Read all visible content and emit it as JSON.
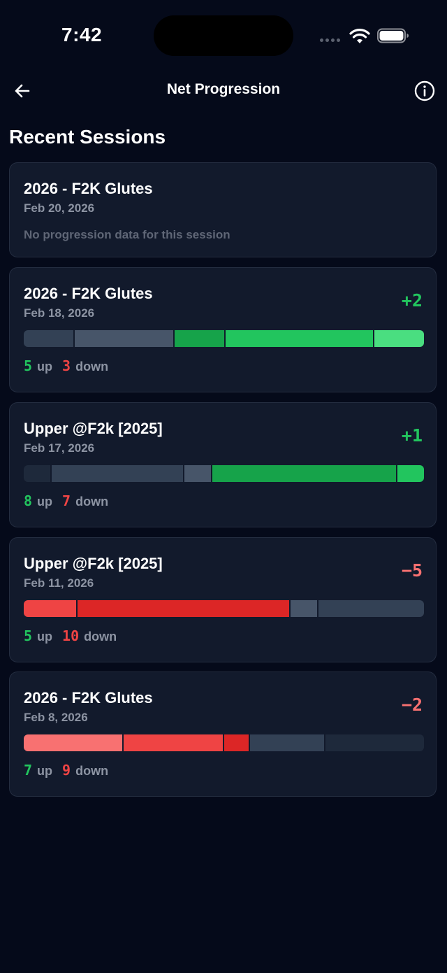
{
  "status": {
    "time": "7:42"
  },
  "nav": {
    "title": "Net Progression",
    "back_icon": "arrow-left-icon",
    "info_icon": "info-circle-icon"
  },
  "section_title": "Recent Sessions",
  "colors": {
    "background": "#050a1a",
    "card": "#121a2c",
    "up": "#22c55e",
    "down": "#ef4444",
    "muted": "#8d94a3"
  },
  "sessions": [
    {
      "name": "2026 - F2K Glutes",
      "date": "Feb 20, 2026",
      "empty_message": "No progression data for this session"
    },
    {
      "name": "2026 - F2K Glutes",
      "date": "Feb 18, 2026",
      "net": "+2",
      "up": "5",
      "down": "3",
      "up_label": "up",
      "down_label": "down",
      "bar": [
        {
          "color": "#334155",
          "share": 0.125
        },
        {
          "color": "#475569",
          "share": 0.25
        },
        {
          "color": "#16a34a",
          "share": 0.125
        },
        {
          "color": "#22c55e",
          "share": 0.375
        },
        {
          "color": "#4ade80",
          "share": 0.125
        }
      ]
    },
    {
      "name": "Upper @F2k [2025]",
      "date": "Feb 17, 2026",
      "net": "+1",
      "up": "8",
      "down": "7",
      "up_label": "up",
      "down_label": "down",
      "bar": [
        {
          "color": "#1e293b",
          "share": 0.067
        },
        {
          "color": "#334155",
          "share": 0.333
        },
        {
          "color": "#475569",
          "share": 0.067
        },
        {
          "color": "#16a34a",
          "share": 0.466
        },
        {
          "color": "#22c55e",
          "share": 0.067
        }
      ]
    },
    {
      "name": "Upper @F2k [2025]",
      "date": "Feb 11, 2026",
      "net": "−5",
      "up": "5",
      "down": "10",
      "up_label": "up",
      "down_label": "down",
      "bar": [
        {
          "color": "#ef4444",
          "share": 0.133
        },
        {
          "color": "#dc2626",
          "share": 0.533
        },
        {
          "color": "#475569",
          "share": 0.067
        },
        {
          "color": "#334155",
          "share": 0.267
        }
      ]
    },
    {
      "name": "2026 - F2K Glutes",
      "date": "Feb 8, 2026",
      "net": "−2",
      "up": "7",
      "down": "9",
      "up_label": "up",
      "down_label": "down",
      "bar": [
        {
          "color": "#f87171",
          "share": 0.25
        },
        {
          "color": "#ef4444",
          "share": 0.25
        },
        {
          "color": "#dc2626",
          "share": 0.0625
        },
        {
          "color": "#334155",
          "share": 0.1875
        },
        {
          "color": "#1e293b",
          "share": 0.25
        }
      ]
    }
  ]
}
